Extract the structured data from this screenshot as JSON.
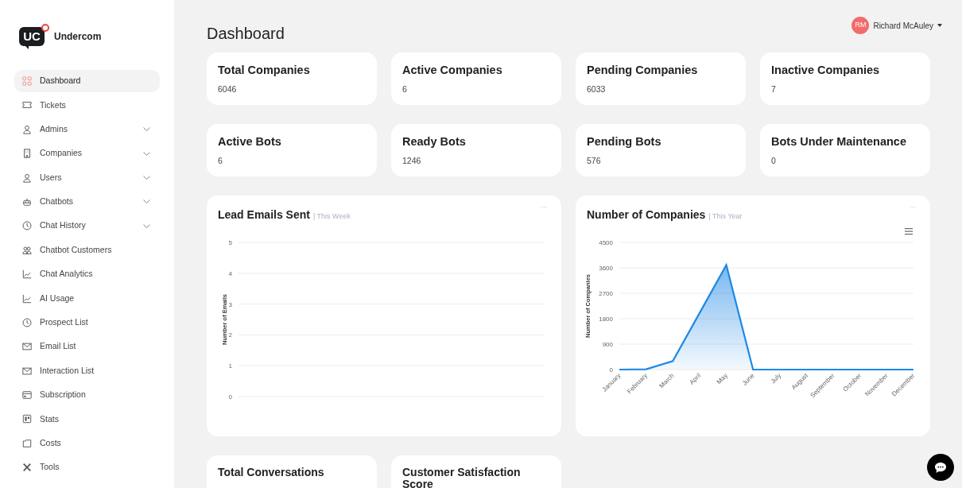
{
  "logo": {
    "mark": "UC",
    "name": "Undercom"
  },
  "sidebar": {
    "items": [
      {
        "label": "Dashboard",
        "selected": true,
        "expandable": false
      },
      {
        "label": "Tickets",
        "selected": false,
        "expandable": false
      },
      {
        "label": "Admins",
        "selected": false,
        "expandable": true
      },
      {
        "label": "Companies",
        "selected": false,
        "expandable": true
      },
      {
        "label": "Users",
        "selected": false,
        "expandable": true
      },
      {
        "label": "Chatbots",
        "selected": false,
        "expandable": true
      },
      {
        "label": "Chat History",
        "selected": false,
        "expandable": true
      },
      {
        "label": "Chatbot Customers",
        "selected": false,
        "expandable": false
      },
      {
        "label": "Chat Analytics",
        "selected": false,
        "expandable": false
      },
      {
        "label": "AI Usage",
        "selected": false,
        "expandable": false
      },
      {
        "label": "Prospect List",
        "selected": false,
        "expandable": false
      },
      {
        "label": "Email List",
        "selected": false,
        "expandable": false
      },
      {
        "label": "Interaction List",
        "selected": false,
        "expandable": false
      },
      {
        "label": "Subscription",
        "selected": false,
        "expandable": false
      },
      {
        "label": "Stats",
        "selected": false,
        "expandable": false
      },
      {
        "label": "Costs",
        "selected": false,
        "expandable": false
      },
      {
        "label": "Tools",
        "selected": false,
        "expandable": false
      }
    ]
  },
  "page_title": "Dashboard",
  "user": {
    "initials": "RM",
    "name": "Richard McAuley"
  },
  "stat_rows": [
    [
      {
        "title": "Total Companies",
        "value": "6046"
      },
      {
        "title": "Active Companies",
        "value": "6"
      },
      {
        "title": "Pending Companies",
        "value": "6033"
      },
      {
        "title": "Inactive Companies",
        "value": "7"
      }
    ],
    [
      {
        "title": "Active Bots",
        "value": "6"
      },
      {
        "title": "Ready Bots",
        "value": "1246"
      },
      {
        "title": "Pending Bots",
        "value": "576"
      },
      {
        "title": "Bots Under Maintenance",
        "value": "0"
      }
    ]
  ],
  "charts": [
    {
      "title": "Lead Emails Sent",
      "period": "| This Week",
      "menu": "...",
      "chart_data": {
        "type": "line",
        "ylabel": "Number of Emails",
        "categories": [
          null,
          null,
          null,
          null,
          null,
          null,
          null
        ],
        "ylim": [
          0,
          5
        ],
        "yticks": [
          0,
          1,
          2,
          3,
          4,
          5
        ],
        "grid": true,
        "series": [
          {
            "values": [
              null,
              null,
              null,
              null,
              null,
              null,
              null
            ]
          }
        ]
      }
    },
    {
      "title": "Number of Companies",
      "period": "| This Year",
      "menu": "...",
      "chart_data": {
        "type": "area",
        "ylabel": "Number of Companies",
        "categories": [
          "January",
          "February",
          "March",
          "April",
          "May",
          "June",
          "July",
          "August",
          "September",
          "October",
          "November",
          "December"
        ],
        "ylim": [
          0,
          4500
        ],
        "yticks": [
          0,
          900,
          1800,
          2700,
          3600,
          4500
        ],
        "grid": true,
        "series": [
          {
            "color": "#1e88e5",
            "values": [
              0,
              10,
              300,
              2000,
              3700,
              0,
              0,
              0,
              0,
              0,
              0,
              0
            ]
          }
        ]
      }
    }
  ],
  "bottom_cards": [
    {
      "title": "Total Conversations"
    },
    {
      "title": "Customer Satisfaction Score"
    }
  ]
}
